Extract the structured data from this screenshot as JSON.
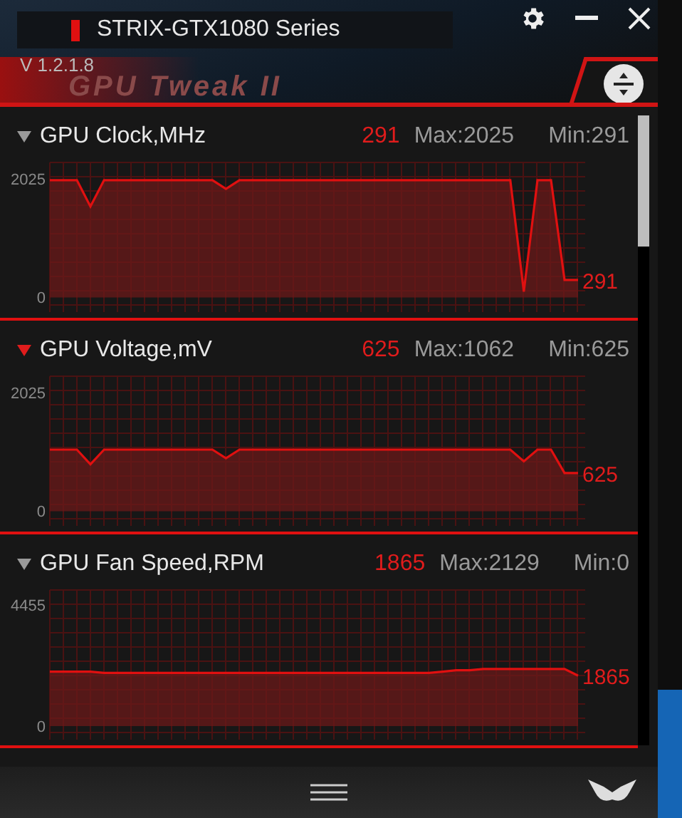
{
  "window": {
    "title": "STRIX-GTX1080 Series",
    "version": "V 1.2.1.8",
    "logo_text": "GPU Tweak II"
  },
  "monitors": [
    {
      "name": "GPU Clock,MHz",
      "current": "291",
      "max": "Max:2025",
      "min": "Min:291",
      "selected": false,
      "end_label": "291",
      "chart_data": {
        "type": "area",
        "grid": true,
        "ylim": [
          -250,
          2300
        ],
        "yticks": [
          0,
          2025
        ],
        "series": [
          {
            "color": "#e01010",
            "values": [
              2000,
              2000,
              2000,
              1550,
              2000,
              2000,
              2000,
              2000,
              2000,
              2000,
              2000,
              2000,
              2000,
              1850,
              2000,
              2000,
              2000,
              2000,
              2000,
              2000,
              2000,
              2000,
              2000,
              2000,
              2000,
              2000,
              2000,
              2000,
              2000,
              2000,
              2000,
              2000,
              2000,
              2000,
              2000,
              100,
              2000,
              2000,
              300,
              300
            ]
          }
        ]
      }
    },
    {
      "name": "GPU Voltage,mV",
      "current": "625",
      "max": "Max:1062",
      "min": "Min:625",
      "selected": true,
      "end_label": "625",
      "chart_data": {
        "type": "area",
        "grid": true,
        "ylim": [
          -250,
          2300
        ],
        "yticks": [
          0,
          2025
        ],
        "series": [
          {
            "color": "#e01010",
            "values": [
              1050,
              1050,
              1050,
              800,
              1050,
              1050,
              1050,
              1050,
              1050,
              1050,
              1050,
              1050,
              1050,
              900,
              1050,
              1050,
              1050,
              1050,
              1050,
              1050,
              1050,
              1050,
              1050,
              1050,
              1050,
              1050,
              1050,
              1050,
              1050,
              1050,
              1050,
              1050,
              1050,
              1050,
              1050,
              850,
              1050,
              1050,
              650,
              650
            ]
          }
        ]
      }
    },
    {
      "name": "GPU Fan Speed,RPM",
      "current": "1865",
      "max": "Max:2129",
      "min": "Min:0",
      "selected": false,
      "end_label": "1865",
      "chart_data": {
        "type": "area",
        "grid": true,
        "ylim": [
          -500,
          5000
        ],
        "yticks": [
          0,
          4455
        ],
        "series": [
          {
            "color": "#e01010",
            "values": [
              2000,
              2000,
              2000,
              2000,
              1950,
              1950,
              1950,
              1950,
              1950,
              1950,
              1950,
              1950,
              1950,
              1950,
              1950,
              1950,
              1950,
              1950,
              1950,
              1950,
              1950,
              1950,
              1950,
              1950,
              1950,
              1950,
              1950,
              1950,
              1950,
              2000,
              2050,
              2050,
              2100,
              2100,
              2100,
              2100,
              2100,
              2100,
              2100,
              1850
            ]
          }
        ]
      }
    }
  ]
}
